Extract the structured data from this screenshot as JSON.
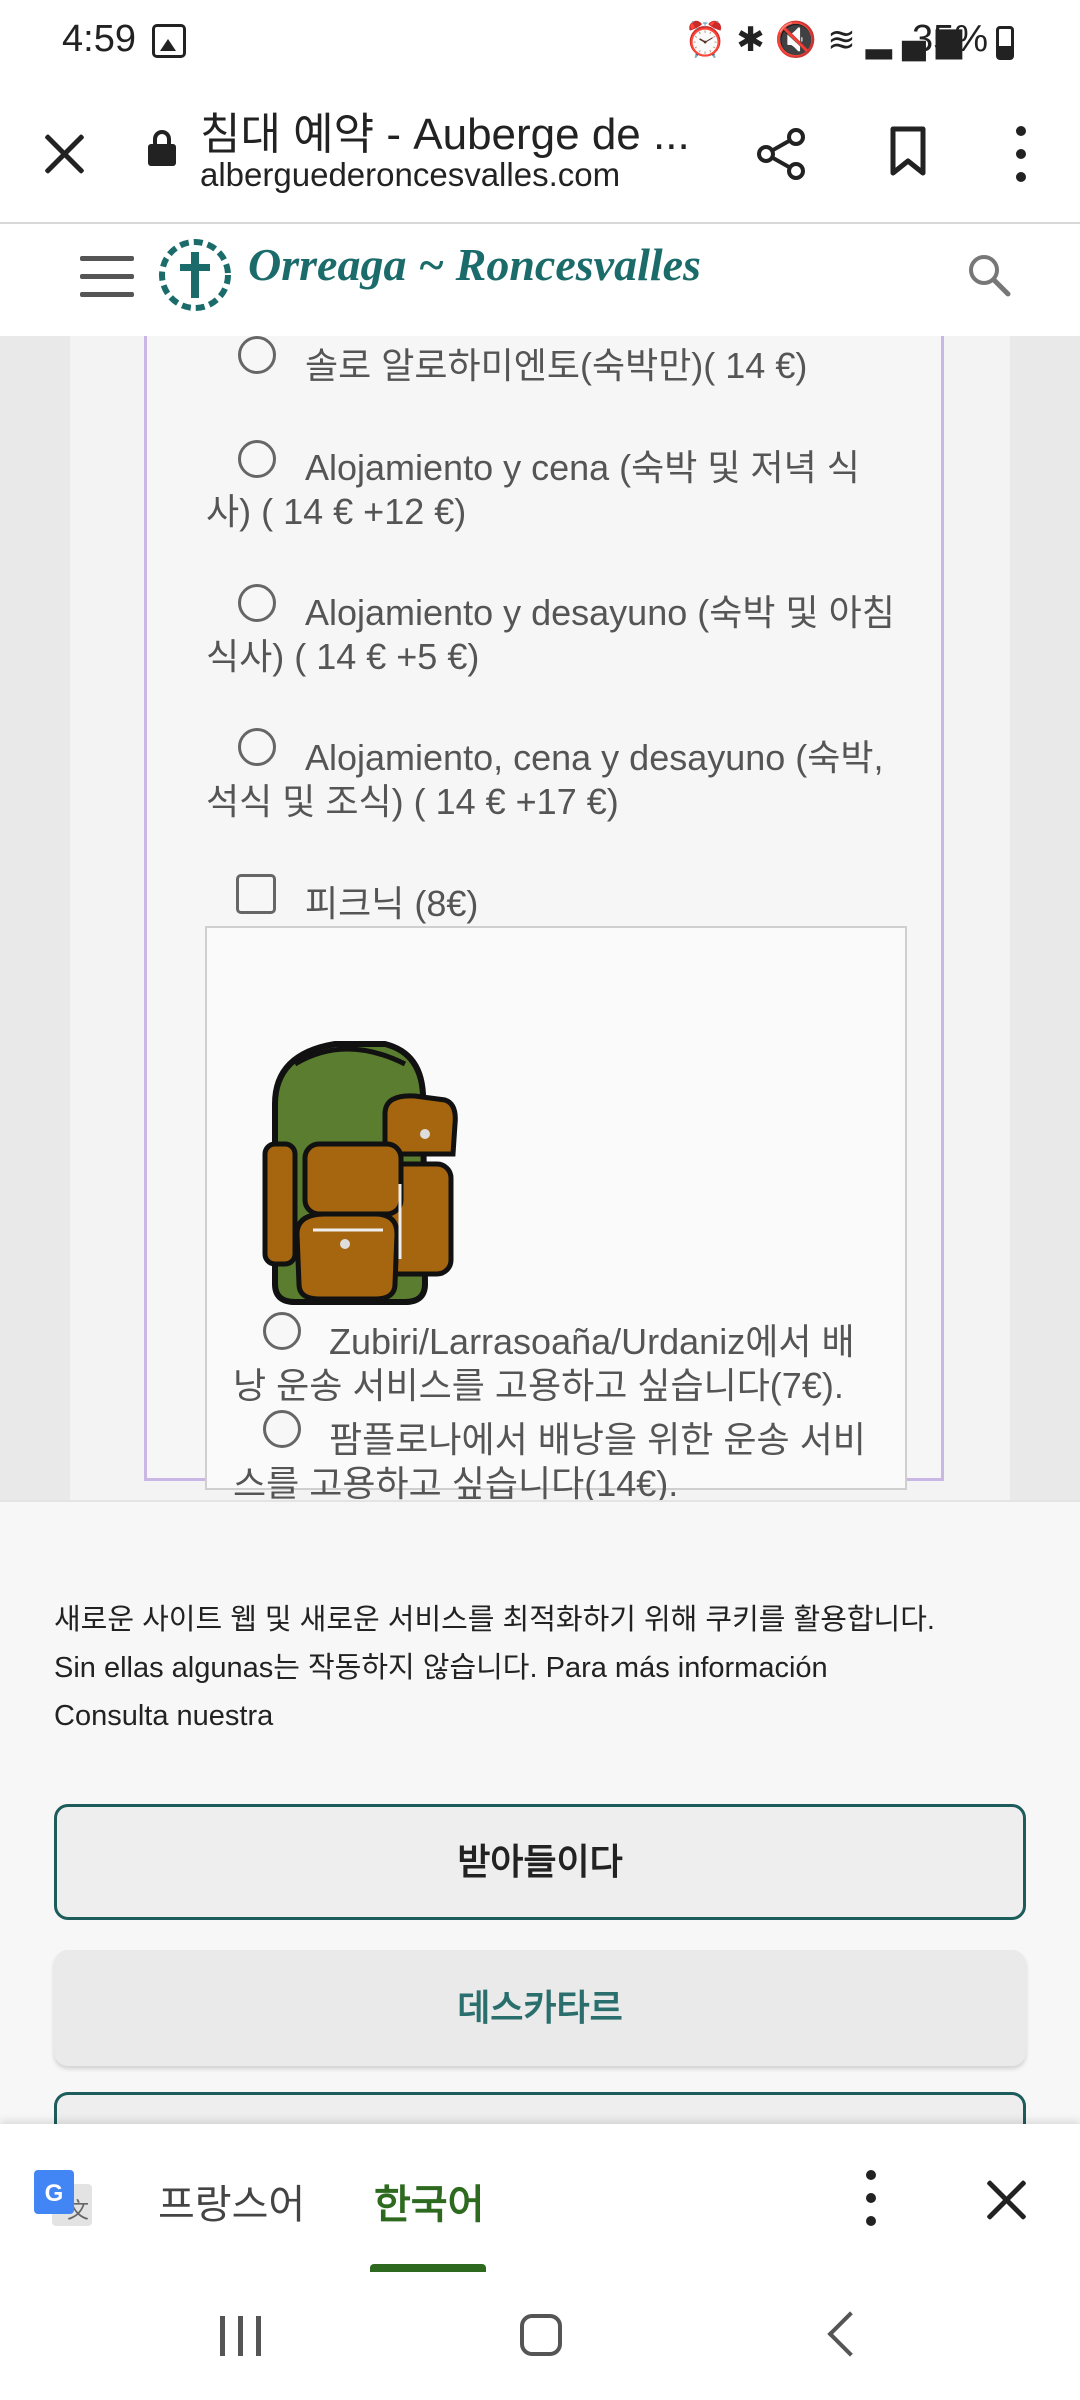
{
  "status_bar": {
    "time": "4:59",
    "battery": "35%"
  },
  "url_bar": {
    "page_title": "침대 예약 - Auberge de ...",
    "domain": "alberguederoncesvalles.com"
  },
  "site_header": {
    "logo_text": "Orreaga ~ Roncesvalles"
  },
  "options": {
    "solo": "솔로 알로하미엔토(숙박만)( 14 €)",
    "cena_line1": "Alojamiento y cena (숙박 및 저녁 식",
    "cena_line2": "사) ( 14 € +12 €)",
    "desayuno_line1": "Alojamiento y desayuno (숙박 및 아침",
    "desayuno_line2": "식사) ( 14 € +5 €)",
    "completo_line1": "Alojamiento, cena y desayuno (숙박,",
    "completo_line2": "석식 및 조식) ( 14 € +17 €)",
    "picnic": "피크닉 (8€)"
  },
  "backpack": {
    "zubiri_line1": "Zubiri/Larrasoaña/Urdaniz에서 배",
    "zubiri_line2": "낭 운송 서비스를 고용하고 싶습니다(7€).",
    "pamplona_line1": "팜플로나에서 배낭을 위한 운송 서비",
    "pamplona_line2": "스를 고용하고 싶습니다(14€)."
  },
  "cookie": {
    "line1": "새로운 사이트 웹 및 새로운 서비스를 최적화하기 위해 쿠키를 활용합니다.",
    "line2": "Sin ellas algunas는 작동하지 않습니다. Para más información",
    "line3": "Consulta nuestra",
    "accept_label": "받아들이다",
    "decline_label": "데스카타르"
  },
  "translate_bar": {
    "source_lang": "프랑스어",
    "target_lang": "한국어"
  },
  "icons": {
    "gallery": "gallery-icon",
    "alarm": "alarm-icon",
    "bluetooth": "bluetooth-icon",
    "mute": "mute-icon",
    "wifi": "wifi-icon",
    "signal": "signal-icon",
    "battery": "battery-icon",
    "close": "close-icon",
    "lock": "lock-icon",
    "share": "share-icon",
    "bookmark": "bookmark-icon",
    "more": "more-vert-icon",
    "menu": "hamburger-icon",
    "search": "search-icon",
    "translate": "google-translate-icon",
    "recents": "recents-icon",
    "home": "home-icon",
    "back": "back-icon"
  },
  "colors": {
    "brand_teal": "#1c6b6b",
    "frame_lavender": "#c9b6e4",
    "translate_green": "#2d6a1f"
  }
}
